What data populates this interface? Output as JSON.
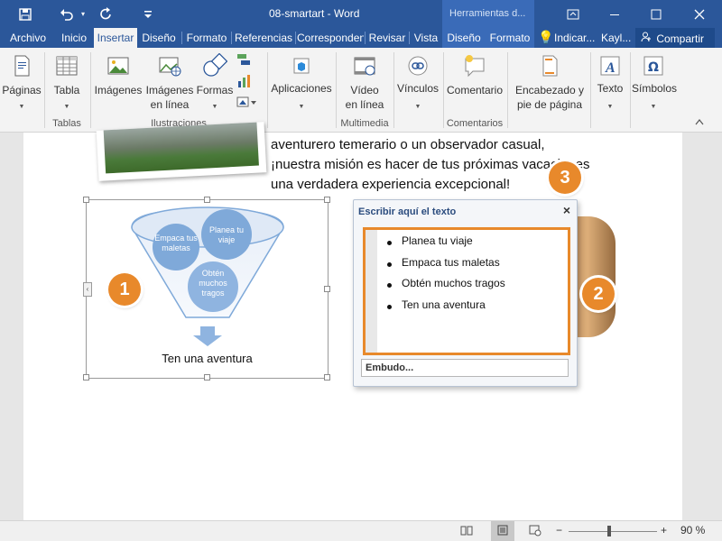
{
  "titlebar": {
    "doc_title": "08-smartart  -  Word",
    "contextual_title": "Herramientas d...",
    "quick_access": [
      "save-icon",
      "undo-icon",
      "redo-icon",
      "customize-icon"
    ],
    "window_controls": [
      "ribbon-display-icon",
      "minimize-icon",
      "maximize-icon",
      "close-icon"
    ]
  },
  "tabs": {
    "items": [
      "Archivo",
      "Inicio",
      "Insertar",
      "Diseño",
      "Formato",
      "Referencias",
      "Correspondencia",
      "Revisar",
      "Vista",
      "Diseño",
      "Formato"
    ],
    "tell_me": "Indicar...",
    "user": "Kayl...",
    "share": "Compartir",
    "active": "Insertar"
  },
  "ribbon": {
    "buttons": {
      "pages": "Páginas",
      "table": "Tabla",
      "images": "Imágenes",
      "online_images_1": "Imágenes",
      "online_images_2": "en línea",
      "shapes": "Formas",
      "apps": "Aplicaciones",
      "video_1": "Vídeo",
      "video_2": "en línea",
      "links": "Vínculos",
      "comment": "Comentario",
      "header_1": "Encabezado y",
      "header_2": "pie de página",
      "text": "Texto",
      "symbols": "Símbolos"
    },
    "groups": {
      "tables": "Tablas",
      "illustrations": "Ilustraciones",
      "multimedia": "Multimedia",
      "comments": "Comentarios"
    }
  },
  "document": {
    "lines": [
      "aventurero temerario o un observador casual,",
      "¡nuestra misión es hacer de tus próximas vacaciones",
      "una verdadera experiencia excepcional!"
    ],
    "smartart": {
      "circle1": "Empaca tus maletas",
      "circle2": "Planea tu viaje",
      "circle3": "Obtén muchos tragos",
      "result": "Ten una aventura"
    }
  },
  "text_pane": {
    "title": "Escribir aquí el texto",
    "items": [
      "Planea tu viaje",
      "Empaca tus maletas",
      "Obtén muchos tragos",
      "Ten una aventura"
    ],
    "footer": "Embudo..."
  },
  "callouts": [
    "1",
    "2",
    "3"
  ],
  "statusbar": {
    "zoom": "90 %"
  },
  "colors": {
    "word_blue": "#2b579a",
    "accent_orange": "#e8892b",
    "smartart_blue": "#7fa9d9"
  }
}
